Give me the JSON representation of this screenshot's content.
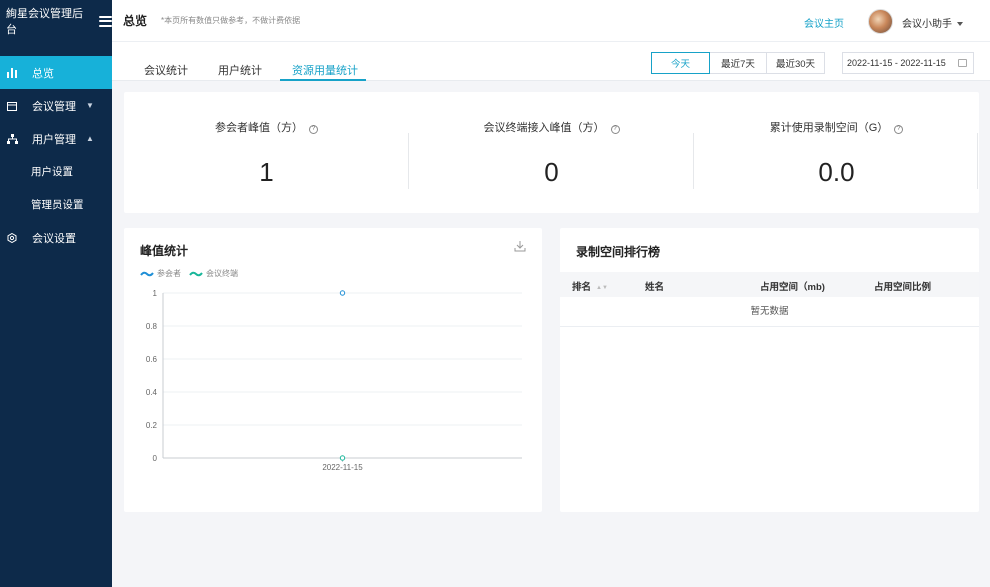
{
  "app": {
    "title": "絢星会议管理后台"
  },
  "sidebar": {
    "items": [
      {
        "label": "总览",
        "icon": "chart-icon"
      },
      {
        "label": "会议管理",
        "icon": "calendar-icon"
      },
      {
        "label": "用户管理",
        "icon": "org-icon"
      },
      {
        "label": "用户设置"
      },
      {
        "label": "管理员设置"
      },
      {
        "label": "会议设置",
        "icon": "settings-icon"
      }
    ]
  },
  "header": {
    "title": "总览",
    "note": "*本页所有数值只做参考，不做计费依据",
    "home_link": "会议主页",
    "username": "会议小助手"
  },
  "tabs": [
    {
      "label": "会议统计"
    },
    {
      "label": "用户统计"
    },
    {
      "label": "资源用量统计"
    }
  ],
  "range": {
    "today": "今天",
    "last7": "最近7天",
    "last30": "最近30天",
    "date_value": "2022-11-15 - 2022-11-15"
  },
  "stats": [
    {
      "label": "参会者峰值（方）",
      "value": "1"
    },
    {
      "label": "会议终端接入峰值（方）",
      "value": "0"
    },
    {
      "label": "累计使用录制空间（G）",
      "value": "0.0"
    }
  ],
  "peak": {
    "title": "峰值统计",
    "legend": [
      "参会者",
      "会议终端"
    ]
  },
  "chart_data": {
    "type": "line",
    "title": "峰值统计",
    "x": [
      "2022-11-15"
    ],
    "series": [
      {
        "name": "参会者",
        "values": [
          1
        ],
        "color": "#1f8fd6"
      },
      {
        "name": "会议终端",
        "values": [
          0
        ],
        "color": "#19b69a"
      }
    ],
    "yticks": [
      "0",
      "0.2",
      "0.4",
      "0.6",
      "0.8",
      "1"
    ],
    "ylim": [
      0,
      1
    ],
    "grid": true,
    "legend": "top-left"
  },
  "ranking": {
    "title": "录制空间排行榜",
    "columns": [
      "排名",
      "姓名",
      "占用空间（mb)",
      "占用空间比例"
    ],
    "empty_text": "暂无数据"
  },
  "colors": {
    "accent": "#17a2c8",
    "sidebar": "#0d2a4a",
    "active": "#17b1d9"
  }
}
